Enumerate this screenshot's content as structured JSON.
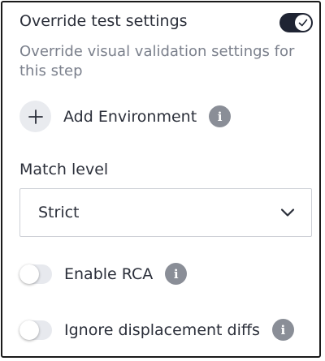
{
  "header": {
    "title": "Override test settings",
    "override_enabled": true,
    "description": "Override visual validation settings for this step"
  },
  "environment": {
    "add_label": "Add Environment",
    "info_glyph": "i"
  },
  "match_level": {
    "label": "Match level",
    "selected": "Strict"
  },
  "toggles": [
    {
      "label": "Enable RCA",
      "enabled": false,
      "info_glyph": "i"
    },
    {
      "label": "Ignore displacement diffs",
      "enabled": false,
      "info_glyph": "i"
    }
  ],
  "colors": {
    "toggle_on": "#1f2433",
    "toggle_off": "#e7e9ee",
    "info_icon": "#8a8e97",
    "muted_text": "#7b808c"
  }
}
